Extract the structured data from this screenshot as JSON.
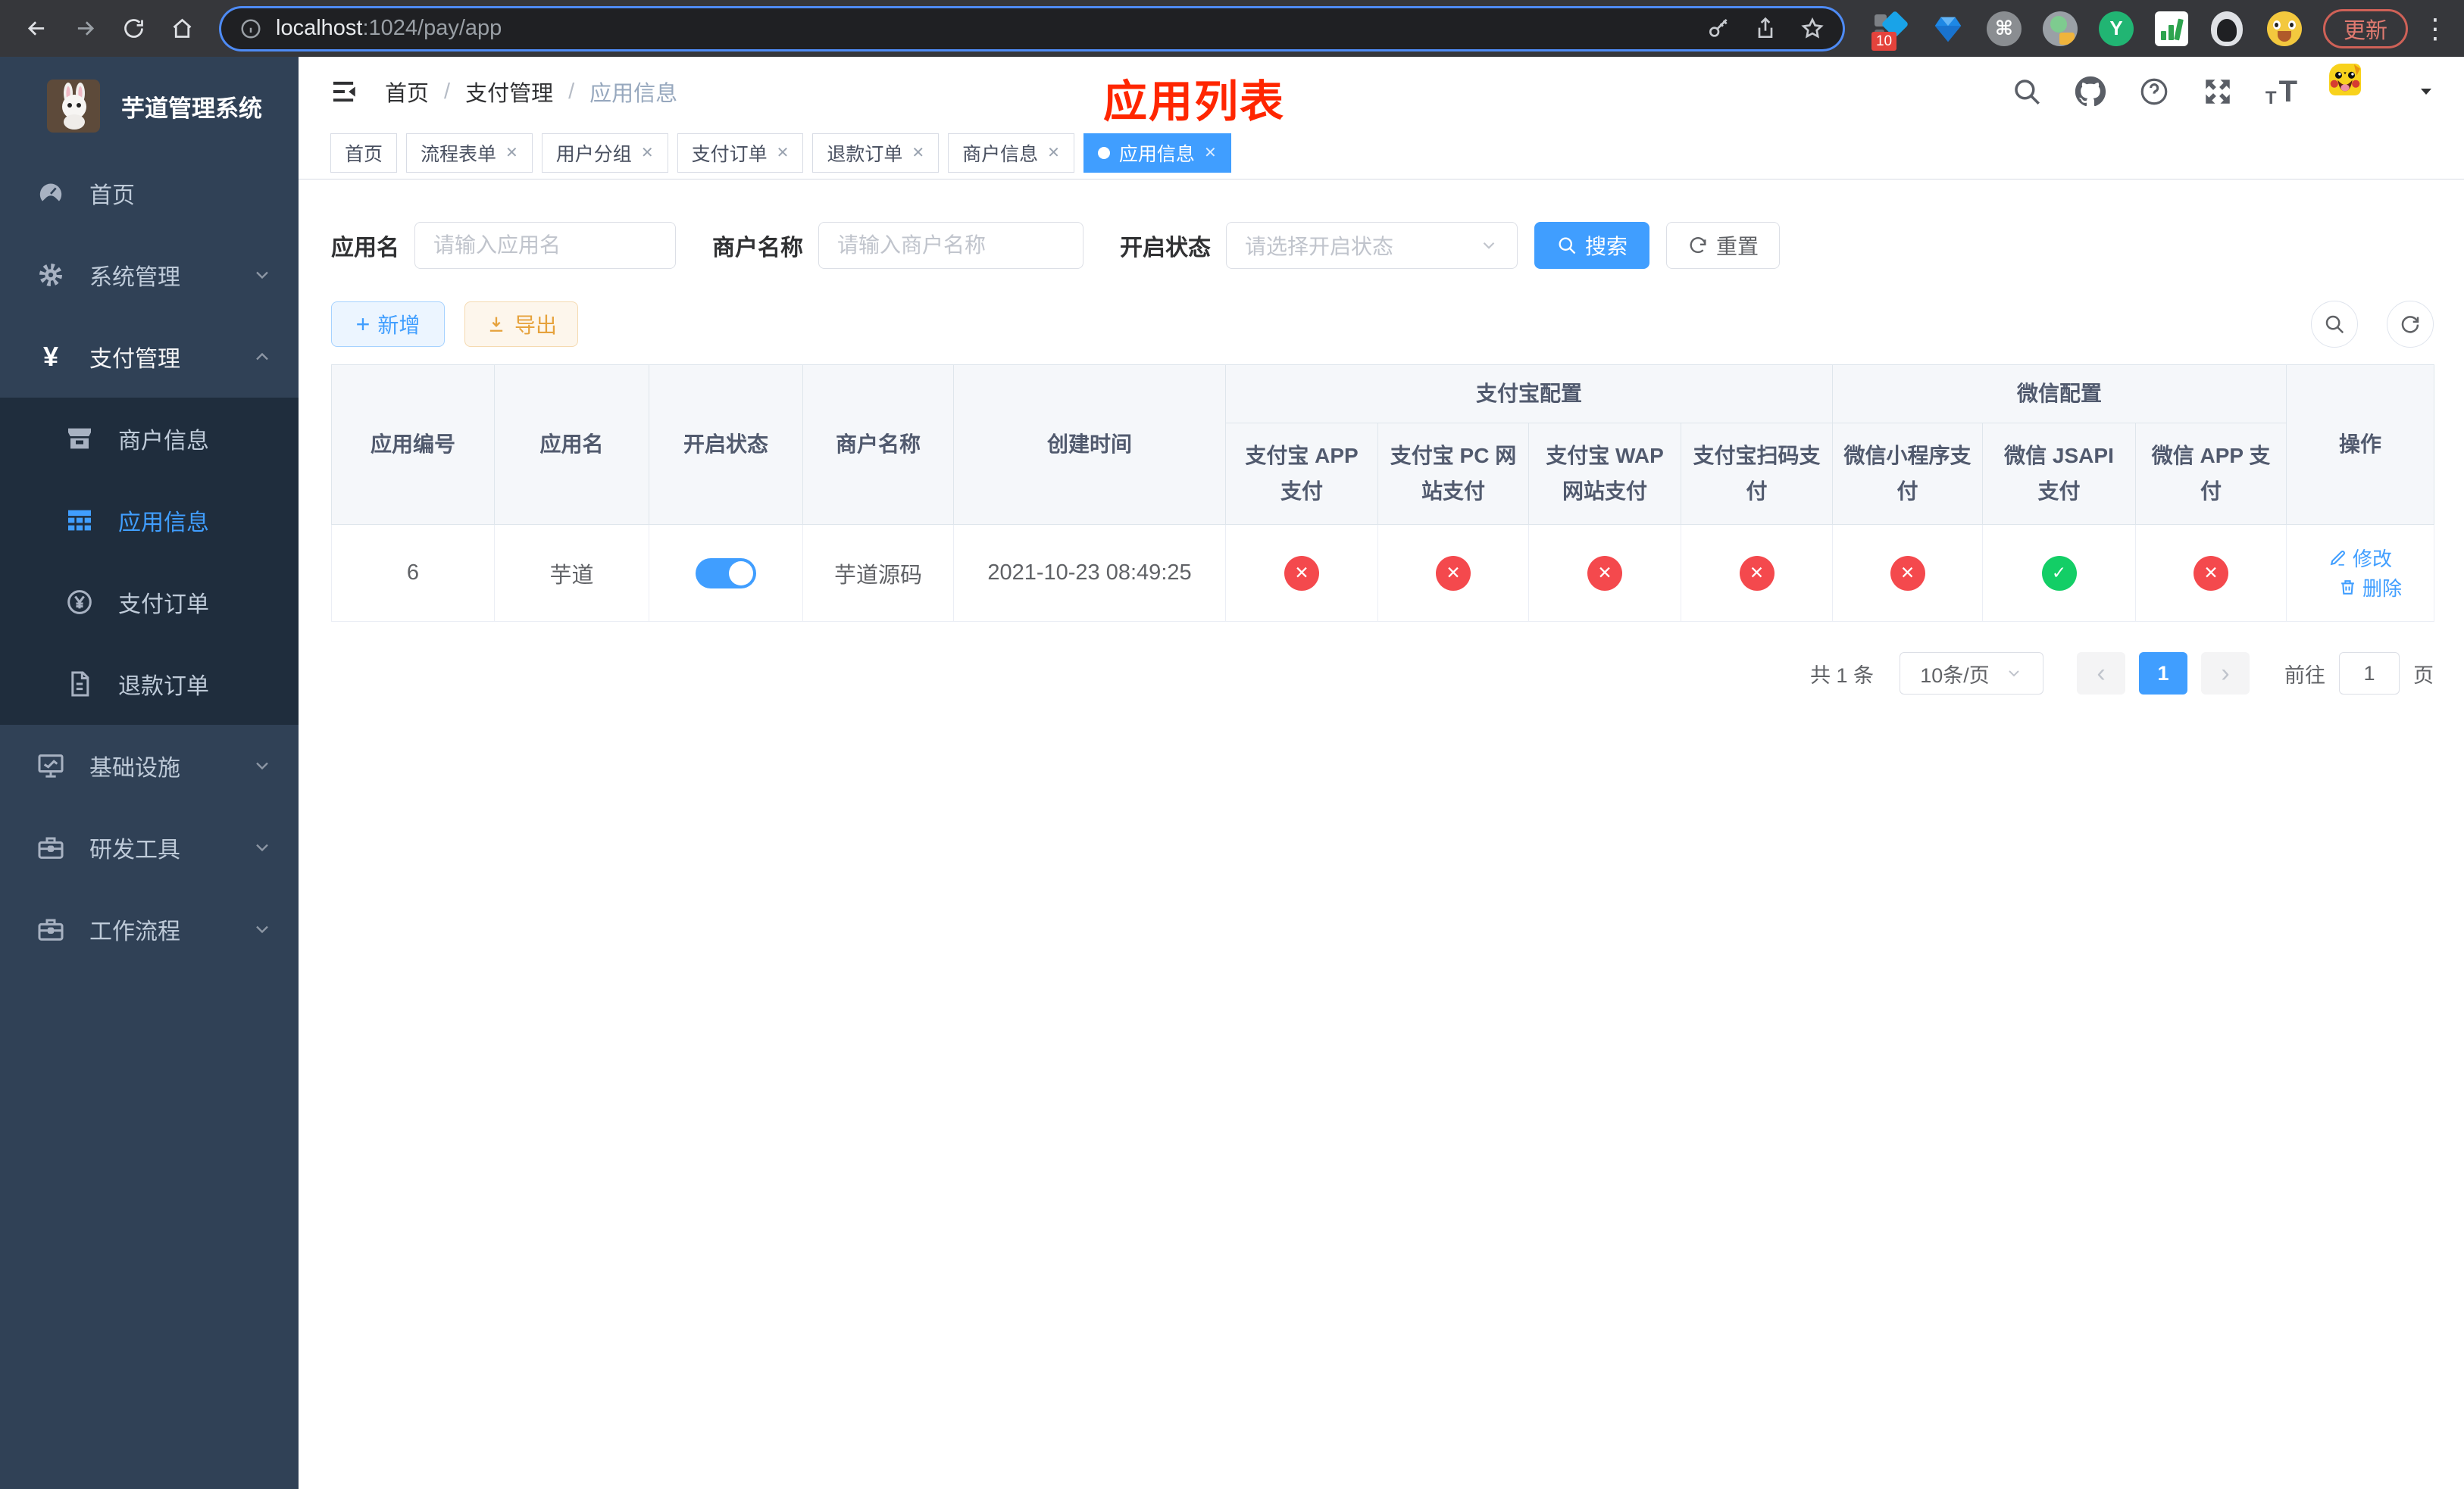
{
  "browser": {
    "url_host": "localhost",
    "url_rest": ":1024/pay/app",
    "update_label": "更新",
    "extension_badge": "10",
    "ext_y_label": "Y"
  },
  "icons": {
    "command": "⌘",
    "kebab": "⋮",
    "plus": "+",
    "yen": "¥",
    "question": "?",
    "t_small": "T",
    "t_big": "T"
  },
  "sidebar": {
    "title": "芋道管理系统",
    "menu": [
      {
        "label": "首页"
      },
      {
        "label": "系统管理"
      },
      {
        "label": "支付管理"
      },
      {
        "label": "基础设施"
      },
      {
        "label": "研发工具"
      },
      {
        "label": "工作流程"
      }
    ],
    "submenu": [
      {
        "label": "商户信息"
      },
      {
        "label": "应用信息"
      },
      {
        "label": "支付订单"
      },
      {
        "label": "退款订单"
      }
    ]
  },
  "header": {
    "breadcrumb": [
      {
        "label": "首页"
      },
      {
        "label": "支付管理"
      },
      {
        "label": "应用信息"
      }
    ],
    "separator": "/",
    "page_title": "应用列表"
  },
  "tabs": [
    {
      "label": "首页"
    },
    {
      "label": "流程表单"
    },
    {
      "label": "用户分组"
    },
    {
      "label": "支付订单"
    },
    {
      "label": "退款订单"
    },
    {
      "label": "商户信息"
    },
    {
      "label": "应用信息"
    }
  ],
  "filters": {
    "app_name_label": "应用名",
    "app_name_placeholder": "请输入应用名",
    "merchant_label": "商户名称",
    "merchant_placeholder": "请输入商户名称",
    "status_label": "开启状态",
    "status_placeholder": "请选择开启状态",
    "search_label": "搜索",
    "reset_label": "重置"
  },
  "toolbar": {
    "add_label": "新增",
    "export_label": "导出"
  },
  "table": {
    "headers": {
      "app_id": "应用编号",
      "app_name": "应用名",
      "status": "开启状态",
      "merchant": "商户名称",
      "created": "创建时间",
      "alipay_group": "支付宝配置",
      "wechat_group": "微信配置",
      "alipay_app": "支付宝 APP 支付",
      "alipay_pc": "支付宝 PC 网站支付",
      "alipay_wap": "支付宝 WAP 网站支付",
      "alipay_qr": "支付宝扫码支付",
      "wx_mini": "微信小程序支付",
      "wx_jsapi": "微信 JSAPI 支付",
      "wx_app": "微信 APP 支付",
      "actions": "操作"
    },
    "rows": [
      {
        "id": "6",
        "name": "芋道",
        "enabled_state": "on",
        "merchant": "芋道源码",
        "created": "2021-10-23 08:49:25",
        "channels": [
          {
            "state": "off",
            "glyph": "✕"
          },
          {
            "state": "off",
            "glyph": "✕"
          },
          {
            "state": "off",
            "glyph": "✕"
          },
          {
            "state": "off",
            "glyph": "✕"
          },
          {
            "state": "off",
            "glyph": "✕"
          },
          {
            "state": "on",
            "glyph": "✓"
          },
          {
            "state": "off",
            "glyph": "✕"
          }
        ],
        "edit_label": "修改",
        "delete_label": "删除"
      }
    ]
  },
  "pagination": {
    "total": "共 1 条",
    "page_size": "10条/页",
    "prev": "‹",
    "next": "›",
    "page": "1",
    "goto_label": "前往",
    "goto_value": "1",
    "unit": "页"
  },
  "colors": {
    "accent": "#409eff",
    "success": "#13ce66",
    "danger": "#f4494d",
    "title_red": "#ff2600",
    "sidebar_bg": "#304156",
    "submenu_bg": "#1f2d3d"
  }
}
